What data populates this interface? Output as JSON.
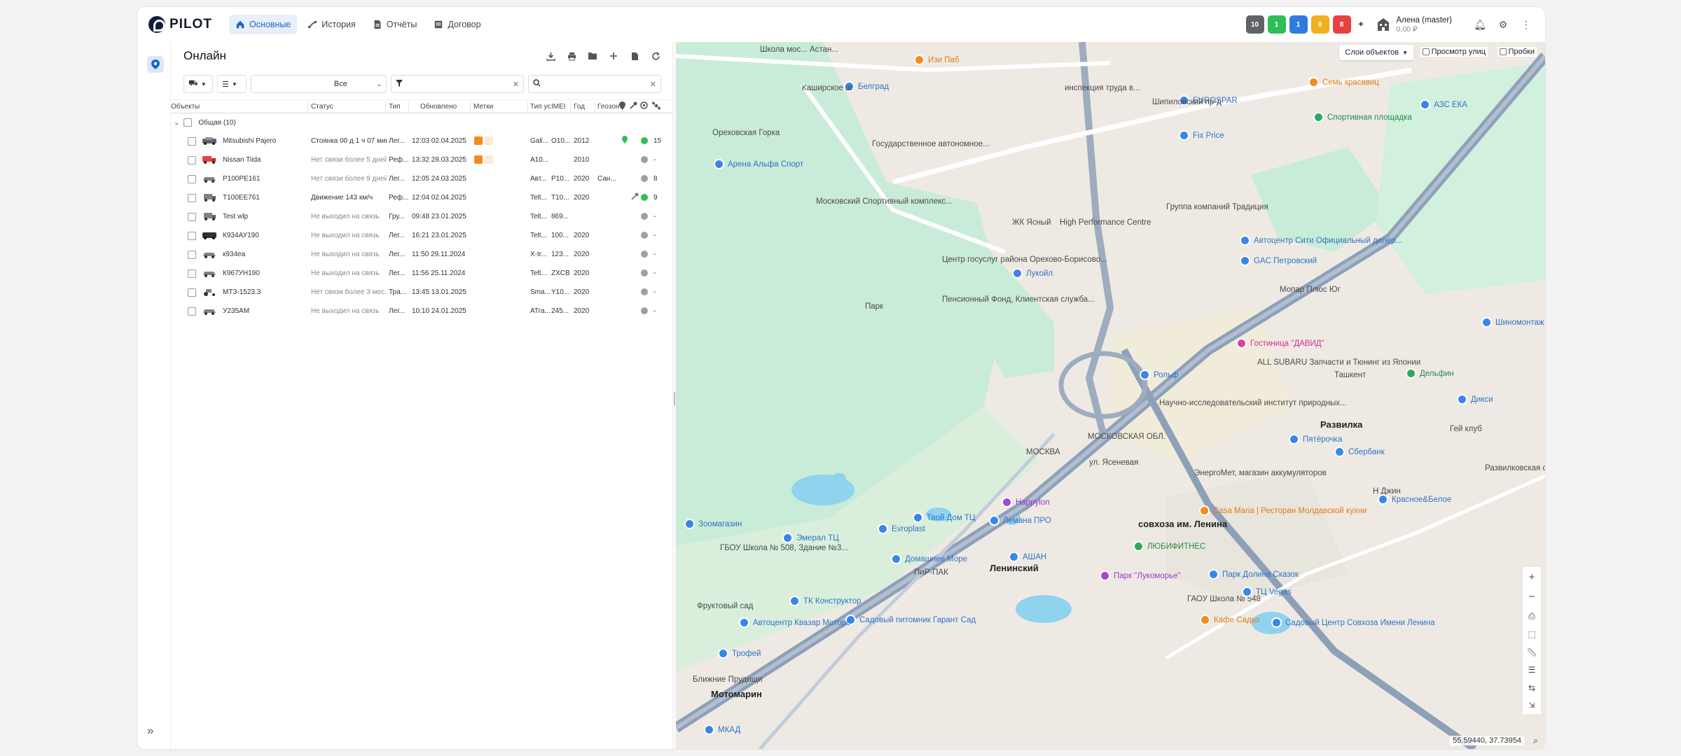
{
  "app": {
    "logo_text": "PILOT"
  },
  "nav": [
    {
      "label": "Основные",
      "icon": "home-icon",
      "active": true
    },
    {
      "label": "История",
      "icon": "route-icon",
      "active": false
    },
    {
      "label": "Отчёты",
      "icon": "report-icon",
      "active": false
    },
    {
      "label": "Договор",
      "icon": "contract-icon",
      "active": false
    }
  ],
  "badges": [
    {
      "value": "10",
      "color": "#5f6368"
    },
    {
      "value": "1",
      "color": "#2fbf55"
    },
    {
      "value": "1",
      "color": "#2f7be0"
    },
    {
      "value": "0",
      "color": "#f2b01e"
    },
    {
      "value": "8",
      "color": "#e8413f"
    }
  ],
  "user": {
    "name": "Алена (master)",
    "balance": "0,00 ₽"
  },
  "panel": {
    "title": "Онлайн",
    "filter_value": "Все",
    "search_placeholder": "",
    "columns": [
      "Объекты",
      "Статус",
      "Тип",
      "Обновлено",
      "Метки",
      "Тип ус",
      "IMEI",
      "Год",
      "Геозон"
    ],
    "group_label": "Общая (10)",
    "rows": [
      {
        "name": "Mitsubishi Pajero",
        "status": "Стоянка 00 д 1 ч 07 мин",
        "type": "Лег...",
        "updated": "12:03 02.04.2025",
        "mark": "#f28c1b",
        "device": "Gali...",
        "imei": "O10...",
        "year": "2012",
        "geo": "",
        "key": "",
        "dot": "#2fbf55",
        "sat": "15",
        "vehicle": "suv"
      },
      {
        "name": "Nissan Tiida",
        "status": "Нет связи более 5 дней",
        "type": "Реф...",
        "updated": "13:32 28.03.2025",
        "mark": "#f28c1b",
        "device": "A10...",
        "imei": "",
        "year": "2010",
        "geo": "",
        "key": "",
        "dot": "#9aa0a6",
        "sat": "-",
        "vehicle": "truck-red"
      },
      {
        "name": "Р100РЕ161",
        "status": "Нет связи более 9 дней",
        "type": "Лег...",
        "updated": "12:05 24.03.2025",
        "mark": "",
        "device": "Авт...",
        "imei": "P10...",
        "year": "2020",
        "geo": "Сан...",
        "key": "",
        "dot": "#9aa0a6",
        "sat": "8",
        "vehicle": "car"
      },
      {
        "name": "Т100ЕЕ761",
        "status": "Движение 143 км/ч",
        "type": "Реф...",
        "updated": "12:04 02.04.2025",
        "mark": "",
        "device": "Telt...",
        "imei": "T10...",
        "year": "2020",
        "geo": "",
        "key": "key",
        "dot": "#2fbf55",
        "sat": "9",
        "vehicle": "truck"
      },
      {
        "name": "Test wlp",
        "status": "Не выходил на связь",
        "type": "Гру...",
        "updated": "09:48 23.01.2025",
        "mark": "",
        "device": "Telt...",
        "imei": "869...",
        "year": "",
        "geo": "",
        "key": "",
        "dot": "#9aa0a6",
        "sat": "-",
        "vehicle": "truck"
      },
      {
        "name": "К934АУ190",
        "status": "Не выходил на связь",
        "type": "Лег...",
        "updated": "16:21 23.01.2025",
        "mark": "",
        "device": "Telt...",
        "imei": "100...",
        "year": "2020",
        "geo": "",
        "key": "",
        "dot": "#9aa0a6",
        "sat": "-",
        "vehicle": "van"
      },
      {
        "name": "к934еа",
        "status": "Не выходил на связь",
        "type": "Лег...",
        "updated": "11:50 29.11.2024",
        "mark": "",
        "device": "X-tr...",
        "imei": "123...",
        "year": "2020",
        "geo": "",
        "key": "",
        "dot": "#9aa0a6",
        "sat": "-",
        "vehicle": "car"
      },
      {
        "name": "К967УН190",
        "status": "Не выходил на связь",
        "type": "Лег...",
        "updated": "11:56 25.11.2024",
        "mark": "",
        "device": "Telt...",
        "imei": "ZXCB",
        "year": "2020",
        "geo": "",
        "key": "",
        "dot": "#9aa0a6",
        "sat": "-",
        "vehicle": "car"
      },
      {
        "name": "МТЗ-1523.3",
        "status": "Нет связи более 3 мес.",
        "type": "Тра...",
        "updated": "13:45 13.01.2025",
        "mark": "",
        "device": "Sma...",
        "imei": "Y10...",
        "year": "2020",
        "geo": "",
        "key": "",
        "dot": "#9aa0a6",
        "sat": "-",
        "vehicle": "tractor"
      },
      {
        "name": "У235АМ",
        "status": "Не выходил на связь",
        "type": "Лег...",
        "updated": "10:10 24.01.2025",
        "mark": "",
        "device": "ATra...",
        "imei": "245...",
        "year": "2020",
        "geo": "",
        "key": "",
        "dot": "#9aa0a6",
        "sat": "-",
        "vehicle": "car"
      }
    ]
  },
  "map": {
    "layers_label": "Слои объектов",
    "street_view_label": "Просмотр улиц",
    "traffic_label": "Пробки",
    "coords": "55.59440, 37.73954",
    "labels": [
      "Изи Паб",
      "Белград",
      "Ореховская Горка",
      "Арена Альфа Спорт",
      "Московский Спортивный комплекс...",
      "Государственное автономное...",
      "ЖК Ясный",
      "High Performance Centre",
      "Группа компаний Традиция",
      "Центр госуслуг района Орехово-Борисово...",
      "Лукойл",
      "Пенсионный Фонд, Клиентская служба...",
      "Парк",
      "EUROSPAR",
      "Fix Price",
      "Семь красавиц",
      "Спортивная площадка",
      "АЗС ЕКА",
      "Автоцентр Сити Официальный дилер...",
      "GAC Петровский",
      "Мопар Плюс Юг",
      "Гостиница \"ДАВИД\"",
      "ALL SUBARU Запчасти и Тюнинг из Японии",
      "Рольф",
      "Научно-исследовательский институт природных...",
      "Развилка",
      "Пятёрочка",
      "Сбербанк",
      "Ташкент",
      "Дельфин",
      "Шиномонтаж",
      "Дикси",
      "Гей клуб",
      "Развилковская средняя общеобразовательная...",
      "ЭнергоМет, магазин аккумуляторов",
      "Н Джин",
      "Красное&Белое",
      "Happylon",
      "Твой Дом ТЦ",
      "Лемана ПРО",
      "АШАН",
      "совхоза им. Ленина",
      "Casa Maria | Ресторан Молдавской кухни",
      "ЛЮБИФИТНЕС",
      "Парк \"Лукоморье\"",
      "Парк Долина Сказок",
      "Ленинский",
      "Домашнее Море",
      "ПиР-ПАК",
      "Evroplast",
      "Эмерал ТЦ",
      "Зоомагазин",
      "ГБОУ Школа № 508, Здание №3...",
      "Фруктовый сад",
      "ТК Конструктор",
      "Садовый питомник Гарант Сад",
      "Автоцентр Квазар Моторс",
      "ГАОУ Школа № 548",
      "ТЦ Vegas",
      "Кафе Садко",
      "Садовый Центр Совхоза Имени Ленина",
      "Трофей",
      "Ближние Прудищи",
      "Мотомарин",
      "МКАД",
      "МОСКВА",
      "МОСКОВСКАЯ ОБЛ.",
      "ул. Ясеневая",
      "Шипиловский пр-д",
      "Каширское ш",
      "инспекция труда в...",
      "Школа мос... Астан..."
    ]
  }
}
